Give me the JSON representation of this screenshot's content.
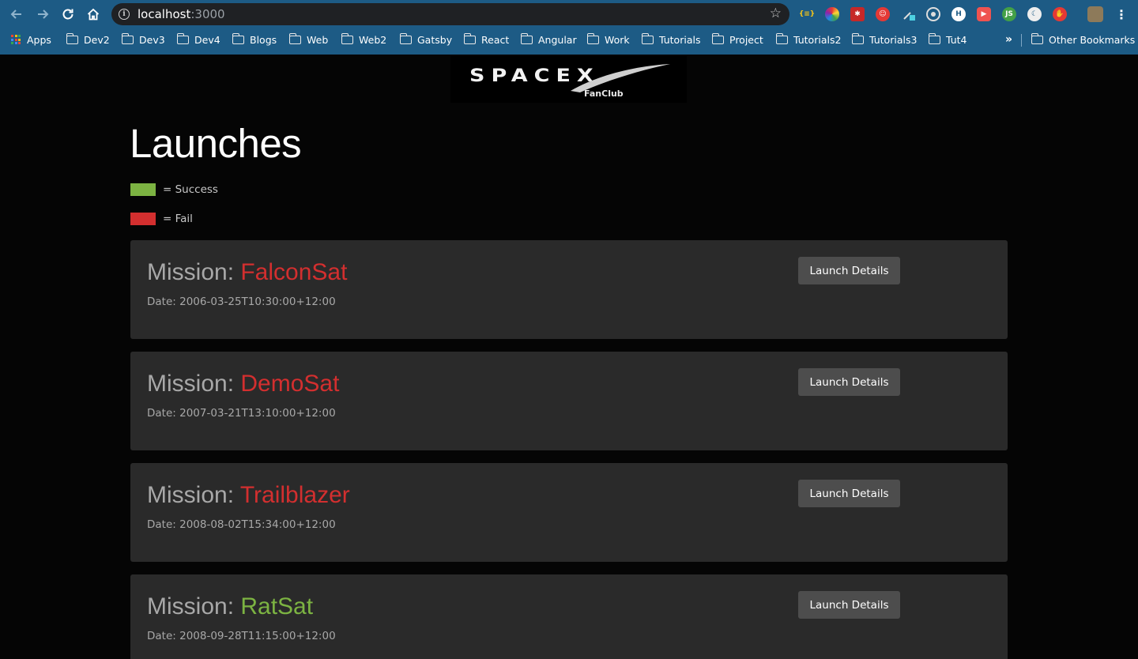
{
  "browser": {
    "url_host": "localhost",
    "url_port": ":3000",
    "bookmarks": [
      "Apps",
      "Dev2",
      "Dev3",
      "Dev4",
      "Blogs",
      "Web",
      "Web2",
      "Gatsby",
      "React",
      "Angular",
      "Work",
      "Tutorials",
      "Project",
      "Tutorials2",
      "Tutorials3",
      "Tut4"
    ],
    "overflow": "»",
    "other_bookmarks": "Other Bookmarks",
    "extension_icons": [
      "json-viewer-icon",
      "color-picker-icon",
      "bug-icon",
      "santa-icon",
      "eyedropper-icon",
      "target-icon",
      "h-icon",
      "video-icon",
      "node-icon",
      "moon-icon",
      "hand-stop-icon"
    ]
  },
  "logo": {
    "main": "SPACEX",
    "sub": "FanClub"
  },
  "page": {
    "title": "Launches",
    "legend": [
      {
        "label": "= Success",
        "color": "#7cb342"
      },
      {
        "label": "= Fail",
        "color": "#d32f2f"
      }
    ]
  },
  "colors": {
    "success": "#7cb342",
    "fail": "#d32f2f",
    "card": "#2a2a2a",
    "button": "#4d4d4d"
  },
  "launches": [
    {
      "prefix": "Mission: ",
      "name": "FalconSat",
      "success": false,
      "date": "Date: 2006-03-25T10:30:00+12:00",
      "button": "Launch Details"
    },
    {
      "prefix": "Mission: ",
      "name": "DemoSat",
      "success": false,
      "date": "Date: 2007-03-21T13:10:00+12:00",
      "button": "Launch Details"
    },
    {
      "prefix": "Mission: ",
      "name": "Trailblazer",
      "success": false,
      "date": "Date: 2008-08-02T15:34:00+12:00",
      "button": "Launch Details"
    },
    {
      "prefix": "Mission: ",
      "name": "RatSat",
      "success": true,
      "date": "Date: 2008-09-28T11:15:00+12:00",
      "button": "Launch Details"
    }
  ]
}
